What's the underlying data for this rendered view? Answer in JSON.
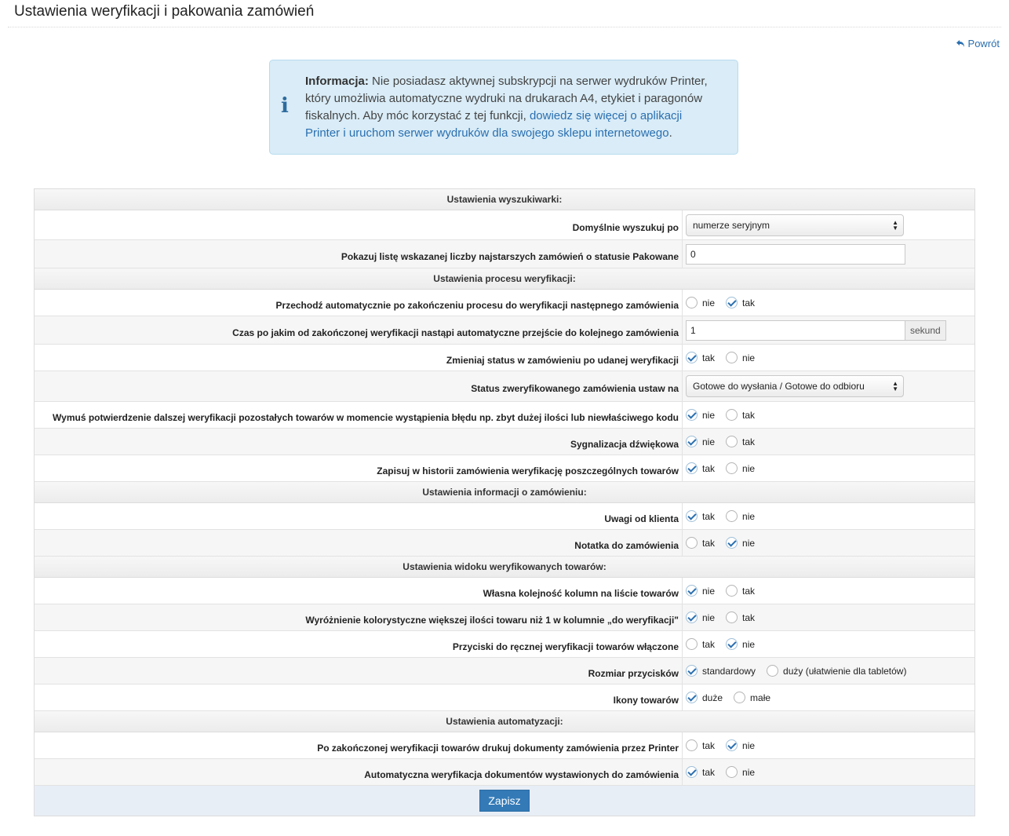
{
  "page": {
    "title": "Ustawienia weryfikacji i pakowania zamówień",
    "back_label": "Powrót"
  },
  "info": {
    "bold": "Informacja:",
    "text_before": " Nie posiadasz aktywnej subskrypcji na serwer wydruków Printer, który umożliwia automatyczne wydruki na drukarach A4, etykiet i paragonów fiskalnych. Aby móc korzystać z tej funkcji, ",
    "link": "dowiedz się więcej o aplikacji Printer i uruchom serwer wydruków dla swojego sklepu internetowego",
    "text_after": "."
  },
  "sections": {
    "search": "Ustawienia wyszukiwarki:",
    "process": "Ustawienia procesu weryfikacji:",
    "order_info": "Ustawienia informacji o zamówieniu:",
    "view": "Ustawienia widoku weryfikowanych towarów:",
    "automation": "Ustawienia automatyzacji:"
  },
  "rows": {
    "default_search": {
      "label": "Domyślnie wyszukuj po",
      "value": "numerze seryjnym"
    },
    "oldest_list": {
      "label": "Pokazuj listę wskazanej liczby najstarszych zamówień o statusie Pakowane",
      "value": "0"
    },
    "auto_next": {
      "label": "Przechodź automatycznie po zakończeniu procesu do weryfikacji następnego zamówienia",
      "opt1": "nie",
      "opt2": "tak"
    },
    "delay": {
      "label": "Czas po jakim od zakończonej weryfikacji nastąpi automatyczne przejście do kolejnego zamówienia",
      "value": "1",
      "unit": "sekund"
    },
    "change_status": {
      "label": "Zmieniaj status w zamówieniu po udanej weryfikacji",
      "opt1": "tak",
      "opt2": "nie"
    },
    "verified_status": {
      "label": "Status zweryfikowanego zamówienia ustaw na",
      "value": "Gotowe do wysłania / Gotowe do odbioru"
    },
    "force_confirm": {
      "label": "Wymuś potwierdzenie dalszej weryfikacji pozostałych towarów w momencie wystąpienia błędu np. zbyt dużej ilości lub niewłaściwego kodu",
      "opt1": "nie",
      "opt2": "tak"
    },
    "sound": {
      "label": "Sygnalizacja dźwiękowa",
      "opt1": "nie",
      "opt2": "tak"
    },
    "history": {
      "label": "Zapisuj w historii zamówienia weryfikację poszczególnych towarów",
      "opt1": "tak",
      "opt2": "nie"
    },
    "client_notes": {
      "label": "Uwagi od klienta",
      "opt1": "tak",
      "opt2": "nie"
    },
    "order_note": {
      "label": "Notatka do zamówienia",
      "opt1": "tak",
      "opt2": "nie"
    },
    "column_order": {
      "label": "Własna kolejność kolumn na liście towarów",
      "opt1": "nie",
      "opt2": "tak"
    },
    "highlight": {
      "label": "Wyróżnienie kolorystyczne większej ilości towaru niż 1 w kolumnie „do weryfikacji\"",
      "opt1": "nie",
      "opt2": "tak"
    },
    "manual_buttons": {
      "label": "Przyciski do ręcznej weryfikacji towarów włączone",
      "opt1": "tak",
      "opt2": "nie"
    },
    "button_size": {
      "label": "Rozmiar przycisków",
      "opt1": "standardowy",
      "opt2": "duży (ułatwienie dla tabletów)"
    },
    "product_icons": {
      "label": "Ikony towarów",
      "opt1": "duże",
      "opt2": "małe"
    },
    "print_docs": {
      "label": "Po zakończonej weryfikacji towarów drukuj dokumenty zamówienia przez Printer",
      "opt1": "tak",
      "opt2": "nie"
    },
    "auto_docs": {
      "label": "Automatyczna weryfikacja dokumentów wystawionych do zamówienia",
      "opt1": "tak",
      "opt2": "nie"
    }
  },
  "footer": {
    "save_label": "Zapisz"
  }
}
